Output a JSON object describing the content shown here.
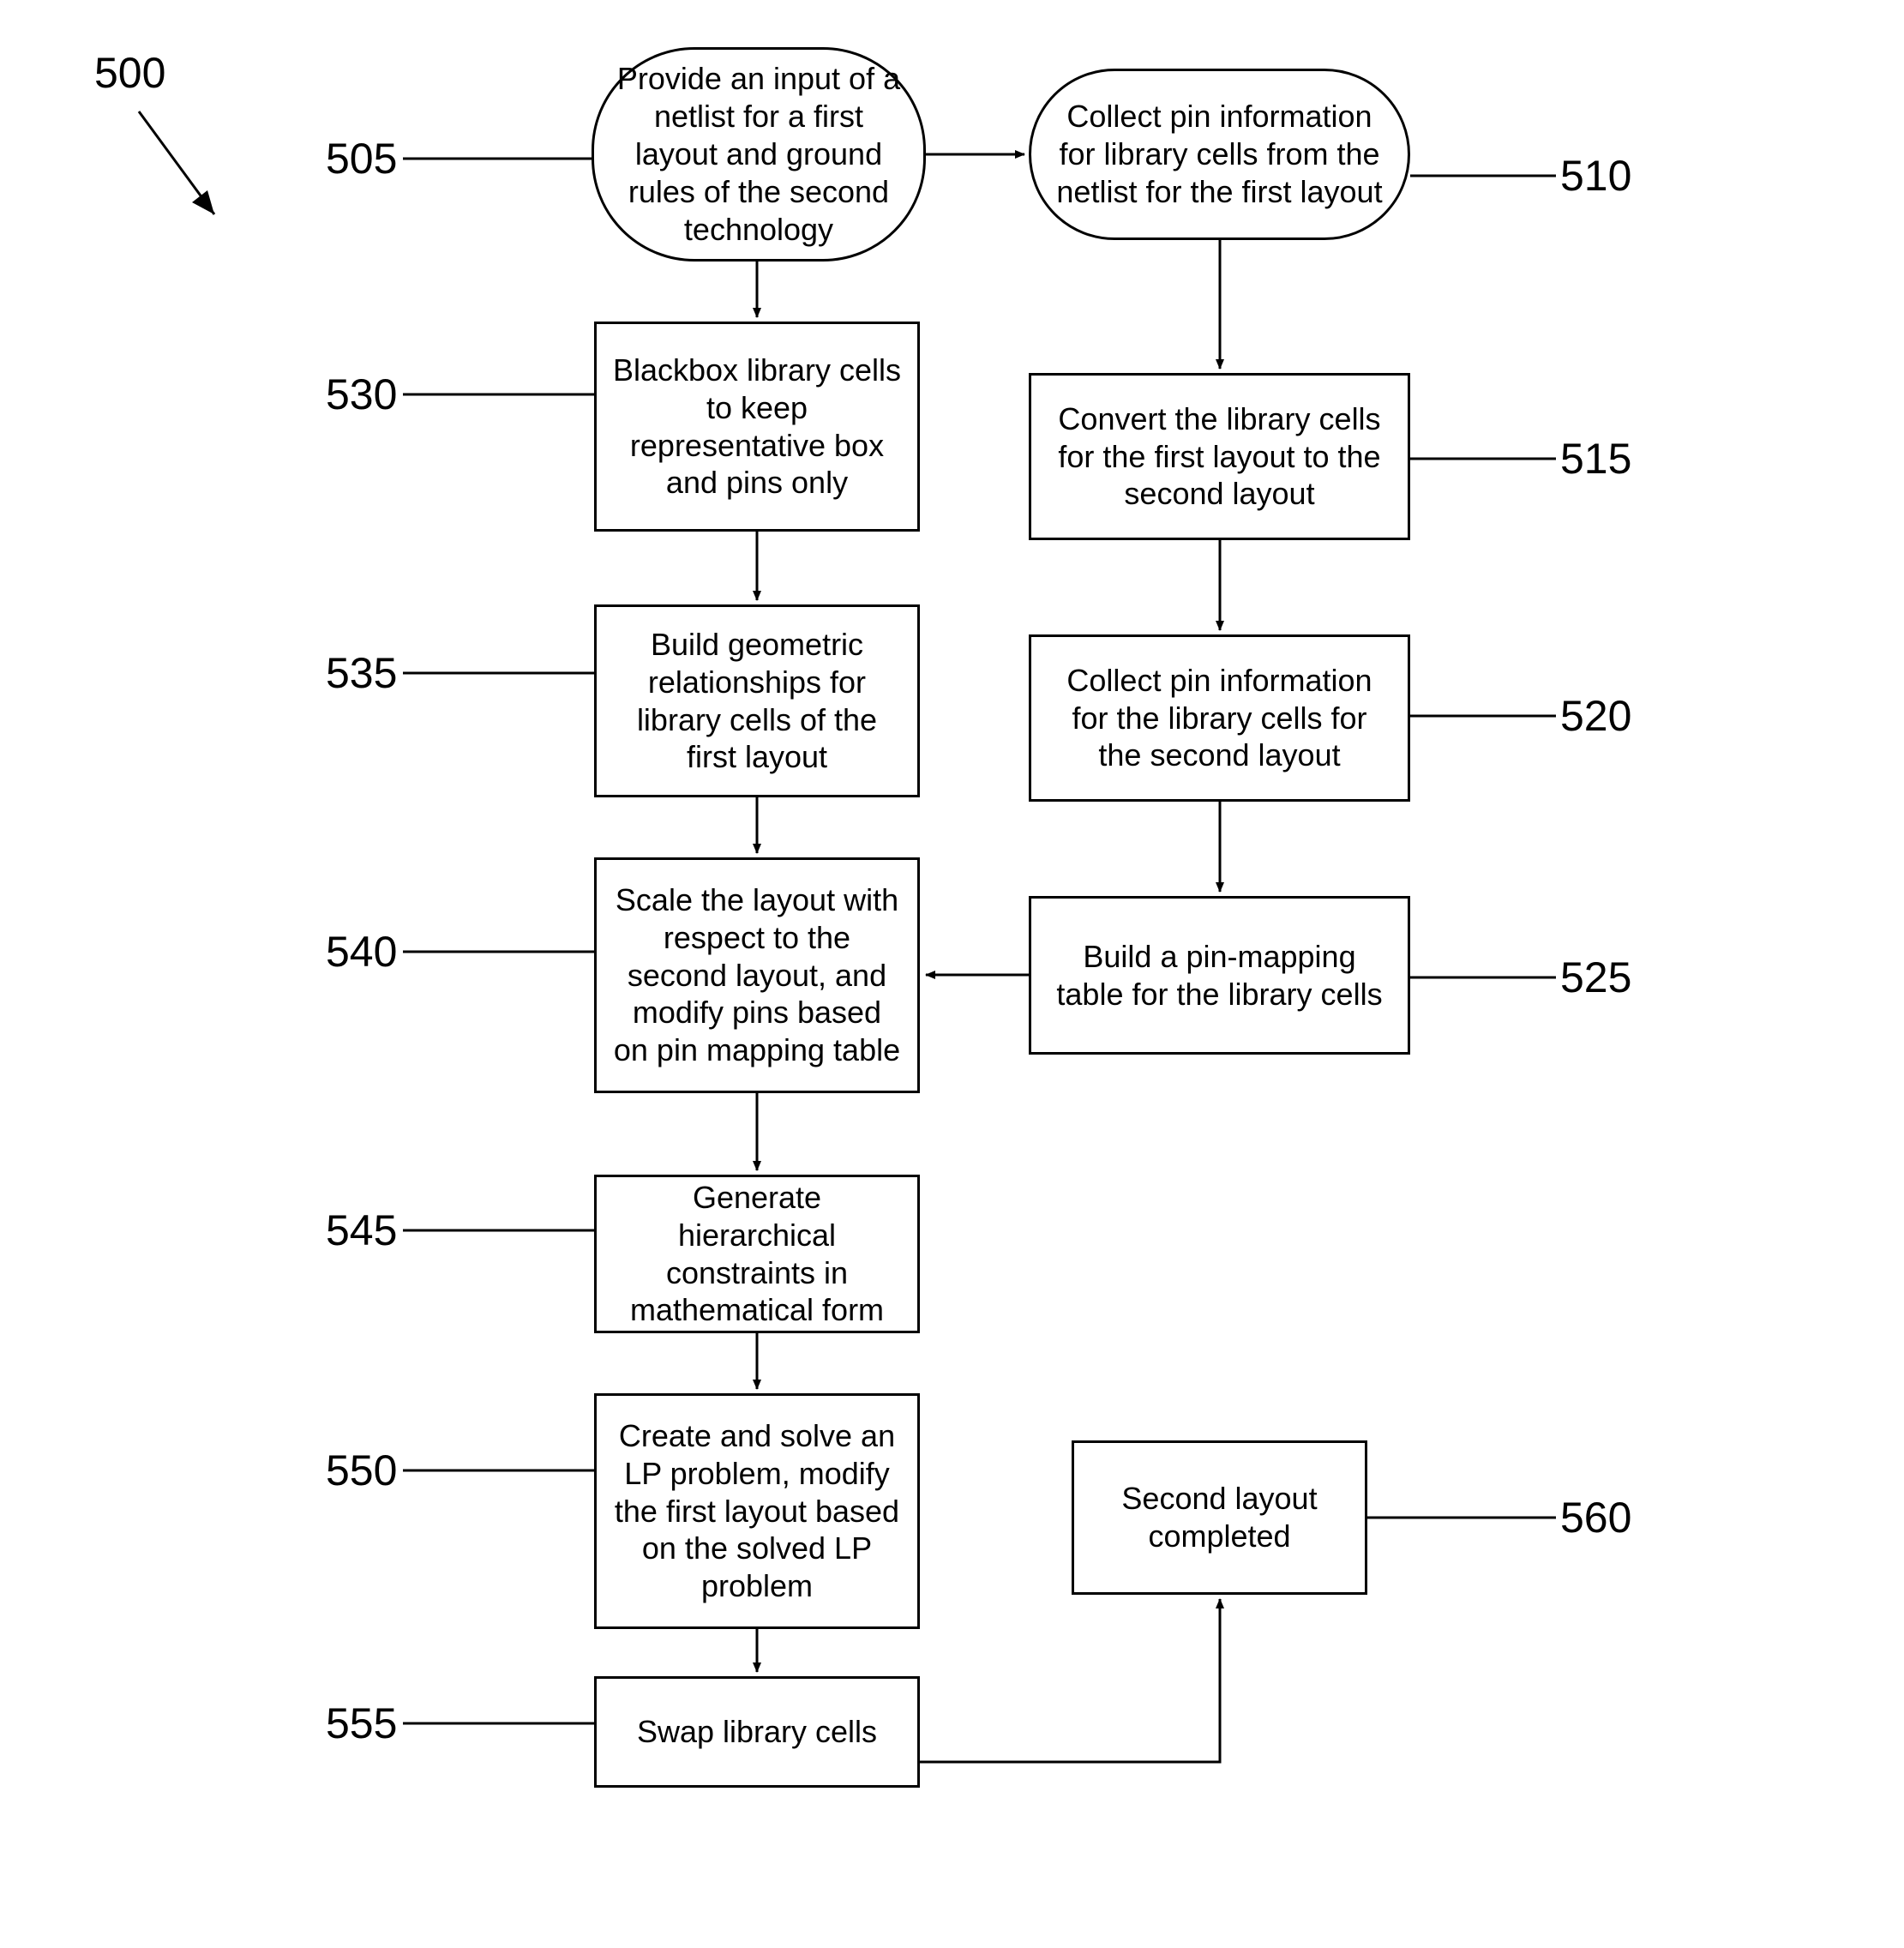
{
  "diagram_id": "500",
  "nodes": {
    "n505": {
      "ref": "505",
      "text": "Provide an input of a netlist for a first layout and ground rules of the second technology"
    },
    "n510": {
      "ref": "510",
      "text": "Collect pin information for library cells from the netlist for the first layout"
    },
    "n515": {
      "ref": "515",
      "text": "Convert the library cells for the first layout to the second layout"
    },
    "n520": {
      "ref": "520",
      "text": "Collect pin information for the library cells for the second layout"
    },
    "n525": {
      "ref": "525",
      "text": "Build a pin-mapping table for the library cells"
    },
    "n530": {
      "ref": "530",
      "text": "Blackbox library cells to keep representative box and pins only"
    },
    "n535": {
      "ref": "535",
      "text": "Build geometric relationships for library cells of the first layout"
    },
    "n540": {
      "ref": "540",
      "text": "Scale the layout with respect to the second layout, and modify pins based on pin mapping table"
    },
    "n545": {
      "ref": "545",
      "text": "Generate hierarchical constraints in mathematical form"
    },
    "n550": {
      "ref": "550",
      "text": "Create and solve an LP problem, modify the first layout based on the solved LP problem"
    },
    "n555": {
      "ref": "555",
      "text": "Swap library cells"
    },
    "n560": {
      "ref": "560",
      "text": "Second layout completed"
    }
  }
}
